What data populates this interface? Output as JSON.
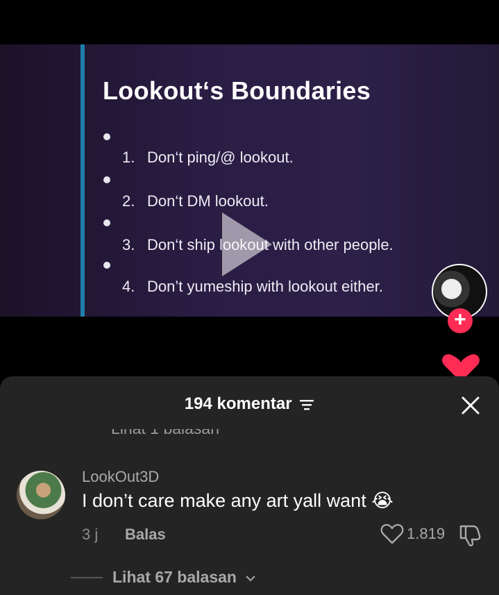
{
  "video": {
    "slide_title": "Lookout‘s Boundaries",
    "items": [
      {
        "num": "1.",
        "text": "Don‘t ping/@ lookout."
      },
      {
        "num": "2.",
        "text": "Don‘t DM lookout."
      },
      {
        "num": "3.",
        "text": "Don‘t ship lookout with other people."
      },
      {
        "num": "4.",
        "text": "Don’t yumeship with lookout either."
      }
    ],
    "follow_label": "+"
  },
  "comments_sheet": {
    "title": "194 komentar",
    "previous_replies": "Lihat 1 balasan",
    "comment": {
      "username": "LookOut3D",
      "text": "I don’t care make any art yall want",
      "emoji": "😭",
      "time": "3 j",
      "reply_label": "Balas",
      "like_count": "1.819"
    },
    "more_replies": "Lihat 67 balasan"
  },
  "colors": {
    "accent_red": "#fe2c55",
    "sheet_bg": "#242424",
    "slide_bar": "#1f7fa8"
  },
  "icons": [
    "play-icon",
    "filter-icon",
    "close-icon",
    "heart-outline-icon",
    "dislike-icon",
    "chevron-down-icon",
    "heart-icon"
  ]
}
